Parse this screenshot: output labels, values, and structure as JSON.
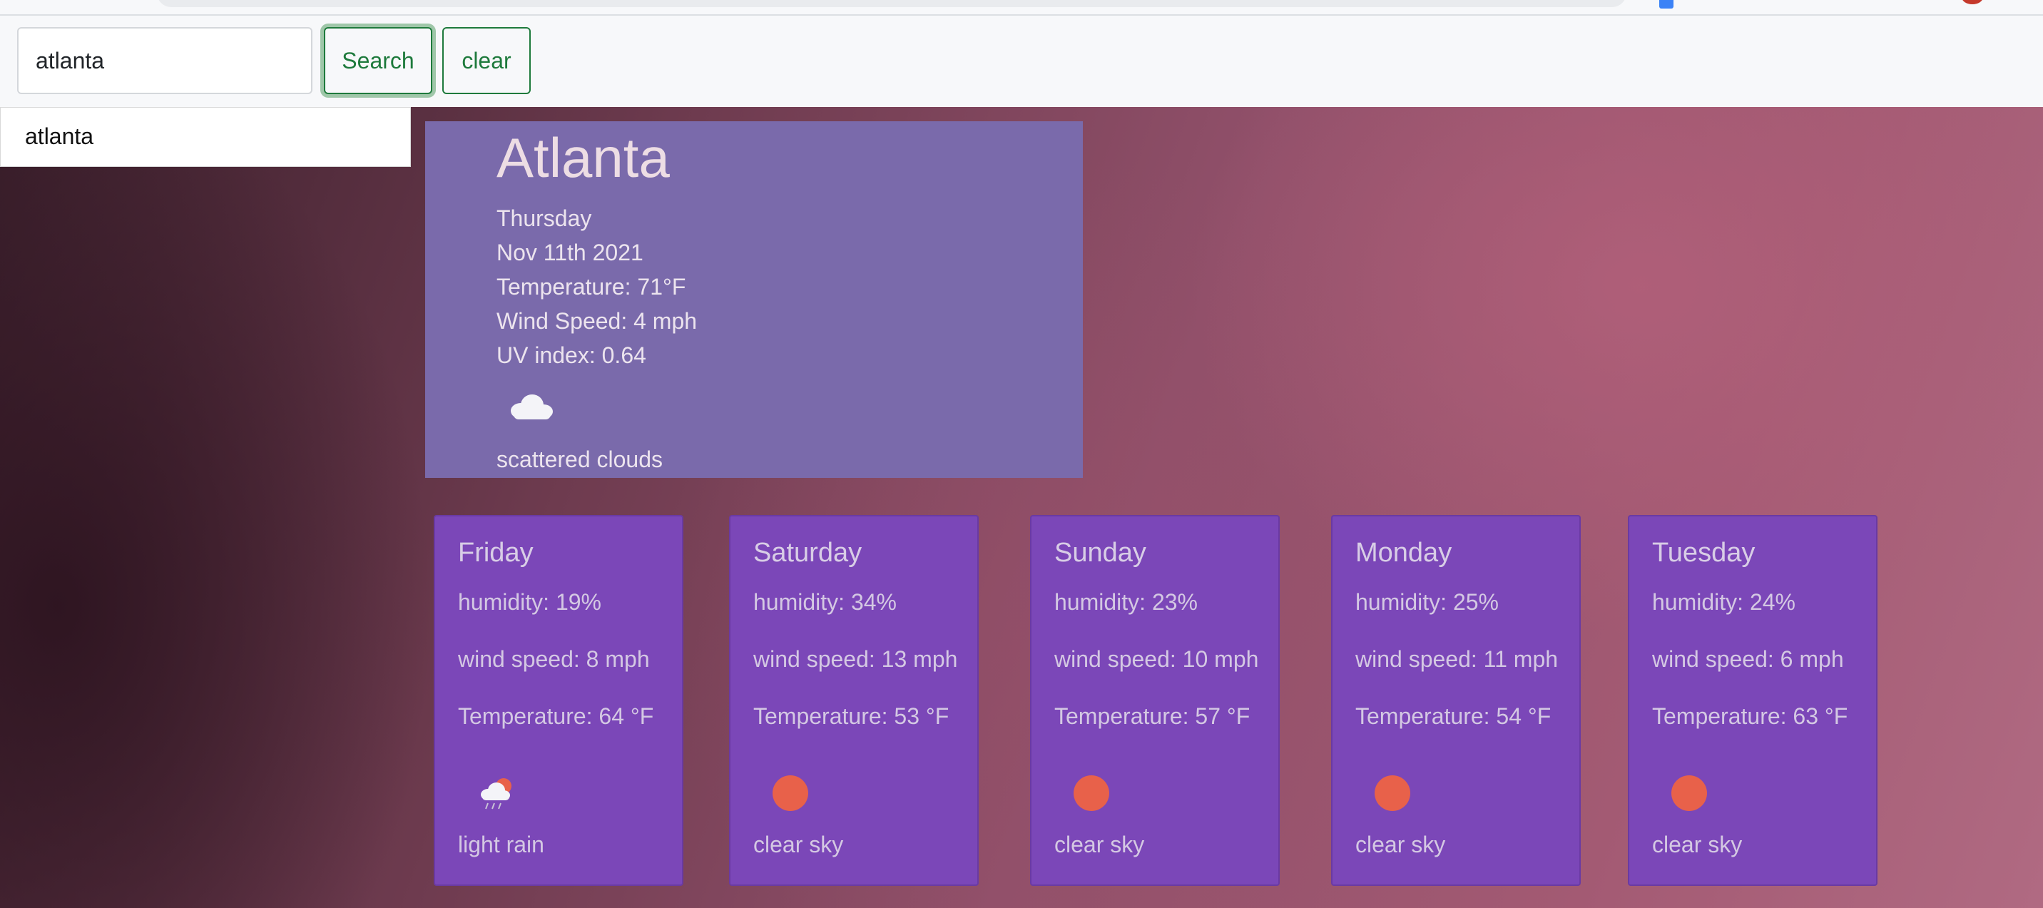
{
  "search": {
    "value": "atlanta",
    "search_label": "Search",
    "clear_label": "clear",
    "suggestion": "atlanta"
  },
  "current": {
    "city": "Atlanta",
    "day": "Thursday",
    "date": "Nov 11th 2021",
    "temperature": "Temperature: 71°F",
    "wind": "Wind Speed: 4 mph",
    "uv": "UV index: 0.64",
    "icon": "scattered-clouds-icon",
    "description": "scattered clouds"
  },
  "forecast": [
    {
      "day": "Friday",
      "humidity": "humidity: 19%",
      "wind": "wind speed: 8 mph",
      "temperature": "Temperature: 64 °F",
      "icon": "light-rain-icon",
      "description": "light rain"
    },
    {
      "day": "Saturday",
      "humidity": "humidity: 34%",
      "wind": "wind speed: 13 mph",
      "temperature": "Temperature: 53 °F",
      "icon": "clear-sky-icon",
      "description": "clear sky"
    },
    {
      "day": "Sunday",
      "humidity": "humidity: 23%",
      "wind": "wind speed: 10 mph",
      "temperature": "Temperature: 57 °F",
      "icon": "clear-sky-icon",
      "description": "clear sky"
    },
    {
      "day": "Monday",
      "humidity": "humidity: 25%",
      "wind": "wind speed: 11 mph",
      "temperature": "Temperature: 54 °F",
      "icon": "clear-sky-icon",
      "description": "clear sky"
    },
    {
      "day": "Tuesday",
      "humidity": "humidity: 24%",
      "wind": "wind speed: 6 mph",
      "temperature": "Temperature: 63 °F",
      "icon": "clear-sky-icon",
      "description": "clear sky"
    }
  ],
  "colors": {
    "current_card": "#7a6aab",
    "forecast_card": "#7b47b8",
    "button_accent": "#1e7a3c",
    "sun": "#e8614a"
  }
}
